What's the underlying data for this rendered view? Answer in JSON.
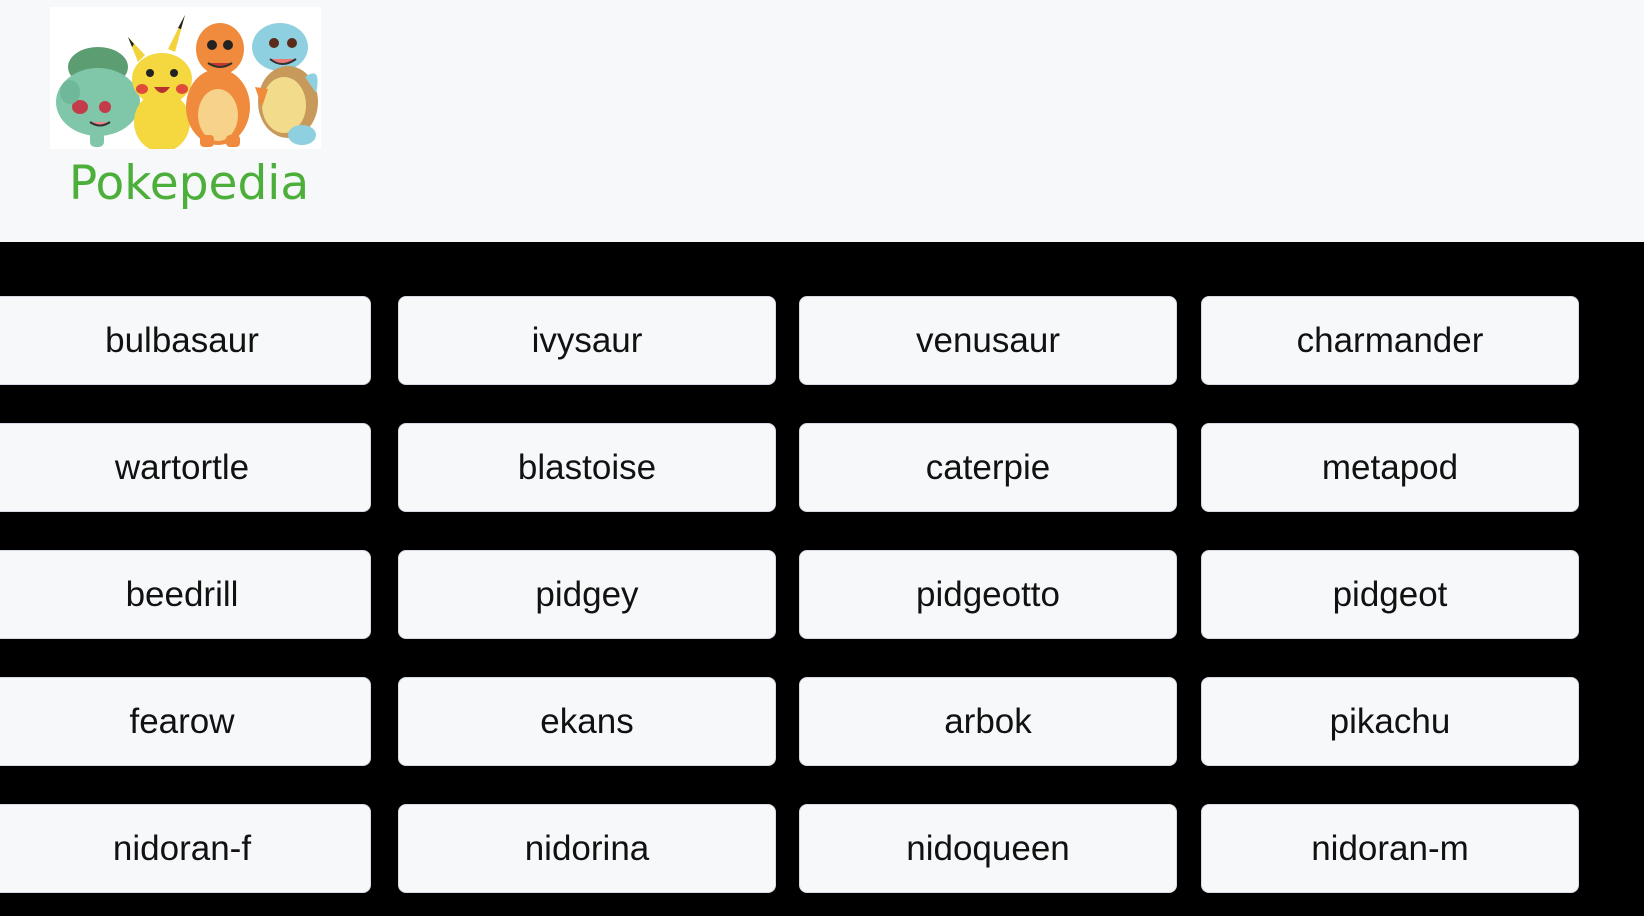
{
  "header": {
    "title": "Pokepedia",
    "logo_alt": "Bulbasaur, Pikachu, Charmander and Squirtle"
  },
  "pokemon": [
    "bulbasaur",
    "ivysaur",
    "venusaur",
    "charmander",
    "wartortle",
    "blastoise",
    "caterpie",
    "metapod",
    "beedrill",
    "pidgey",
    "pidgeotto",
    "pidgeot",
    "fearow",
    "ekans",
    "arbok",
    "pikachu",
    "nidoran-f",
    "nidorina",
    "nidoqueen",
    "nidoran-m"
  ],
  "colors": {
    "title_green": "#4caf3a",
    "background": "#000000",
    "header_bg": "#f7f8fa",
    "card_bg": "#f7f8fa"
  }
}
